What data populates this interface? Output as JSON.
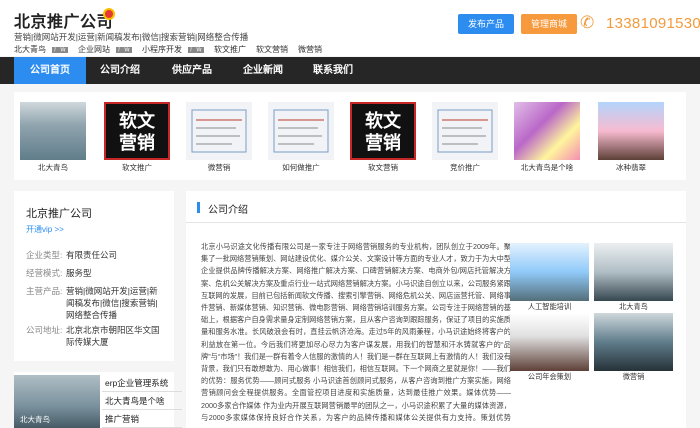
{
  "header": {
    "title": "北京推广公司",
    "subline": "营销|微网站开发|运营|新闻稿发布|微信|搜索营销|网络整合传播",
    "links": [
      {
        "label": "北大青鸟",
        "tag": "广告"
      },
      {
        "label": "企业网站",
        "tag": "广告"
      },
      {
        "label": "小程序开发",
        "tag": "广告"
      },
      {
        "label": "软文推广",
        "tag": ""
      },
      {
        "label": "软文营销",
        "tag": ""
      },
      {
        "label": "微营销",
        "tag": ""
      }
    ],
    "publish_button": "发布产品",
    "mall_button": "管理商城",
    "phone": "13381091530"
  },
  "nav": {
    "items": [
      "公司首页",
      "公司介绍",
      "供应产品",
      "企业新闻",
      "联系我们"
    ],
    "active_index": 0
  },
  "gallery": [
    {
      "caption": "北大青鸟",
      "type": "office"
    },
    {
      "caption": "软文推广",
      "type": "rw",
      "text": "软文\n营销"
    },
    {
      "caption": "微营销",
      "type": "white"
    },
    {
      "caption": "如何做推广",
      "type": "white"
    },
    {
      "caption": "软文营销",
      "type": "rw",
      "text": "软文\n营销"
    },
    {
      "caption": "竞价推广",
      "type": "white"
    },
    {
      "caption": "北大青鸟是个啥",
      "type": "purple"
    },
    {
      "caption": "冰种翡翠",
      "type": "group"
    }
  ],
  "sidebar": {
    "company": "北京推广公司",
    "vip": "开通vip >>",
    "rows": [
      {
        "k": "企业类型:",
        "v": "有限责任公司"
      },
      {
        "k": "经营模式:",
        "v": "服务型"
      },
      {
        "k": "主营产品:",
        "v": "营销|微网站开发|运营|新闻稿发布|微信|搜索营销|网络整合传播"
      },
      {
        "k": "公司地址:",
        "v": "北京北京市朝阳区华文国际传媒大厦"
      }
    ]
  },
  "sidebar2": {
    "image_caption": "北大青鸟",
    "items": [
      "erp企业管理系统",
      "北大青鸟是个啥",
      "推广营销"
    ]
  },
  "main": {
    "title": "公司介绍",
    "paragraph": "北京小马识途文化传播有限公司是一家专注于网络营销服务的专业机构，团队创立于2009年。聚集了一批网络营销策划、网站建设优化、媒介公关、文案设计等方面的专业人才，致力于为大中型企业提供品牌传播解决方案、网络推广解决方案、口碑营销解决方案、电商外包/网店托管解决方案、危机公关解决方案及重点行业一站式网络营销解决方案。小马识途自创立以来，公司服务紧跟互联网的发展，目前已包括新闻软文传播、搜索引擎营销、网络危机公关、网店运营托管、网络事件营销、新媒体营销、知识营销、微电影营销、网络营销培训服务方案。公司专注于网络营销的基础上，根据客户自身需求量身定制网络营销方案，且从客户咨询到跟踪服务，保证了项目的实施质量和服务水准。长风破浪会有时，直挂云帆济沧海。走过5年的风雨兼程，小马识途始终将客户的利益放在第一位。今后我们将更加尽心尽力为客户谋发展，用我们的智慧和汗水铸就客户的“品牌”与“市场”！我们是一群有着令人信服的激情的人！我们是一群在互联网上有激情的人！我们没有背景，我们只有敢想敢为、用心做事！相信我们，相信互联网。下一个网商之星就是你！——我们的优势：服务优势——顾问式服务 小马识途首创顾问式服务，从客户咨询到推广方案实施，网络营销顾问会全程提供服务。全面管控项目进度和实施质量，达到最佳推广效果。媒体优势——2000多家合作媒体 作为业内开展互联网营销最早的团队之一，小马识途积累了大量的媒体资源，与2000多家媒体保持良好合作关系，为客户的品牌传播和媒体公关提供有力支持。策划优势——“经验的策划团队”小马识途的策划团队，能为各类企业提供一站式网络营销解决方案。",
    "photos": [
      {
        "caption": "人工智能培训"
      },
      {
        "caption": "北大青鸟"
      },
      {
        "caption": "公司年会策划"
      },
      {
        "caption": "微营销"
      }
    ]
  },
  "colors": {
    "accent": "#2d8cf0",
    "orange": "#f79a3e",
    "nav_bg": "#262626"
  }
}
